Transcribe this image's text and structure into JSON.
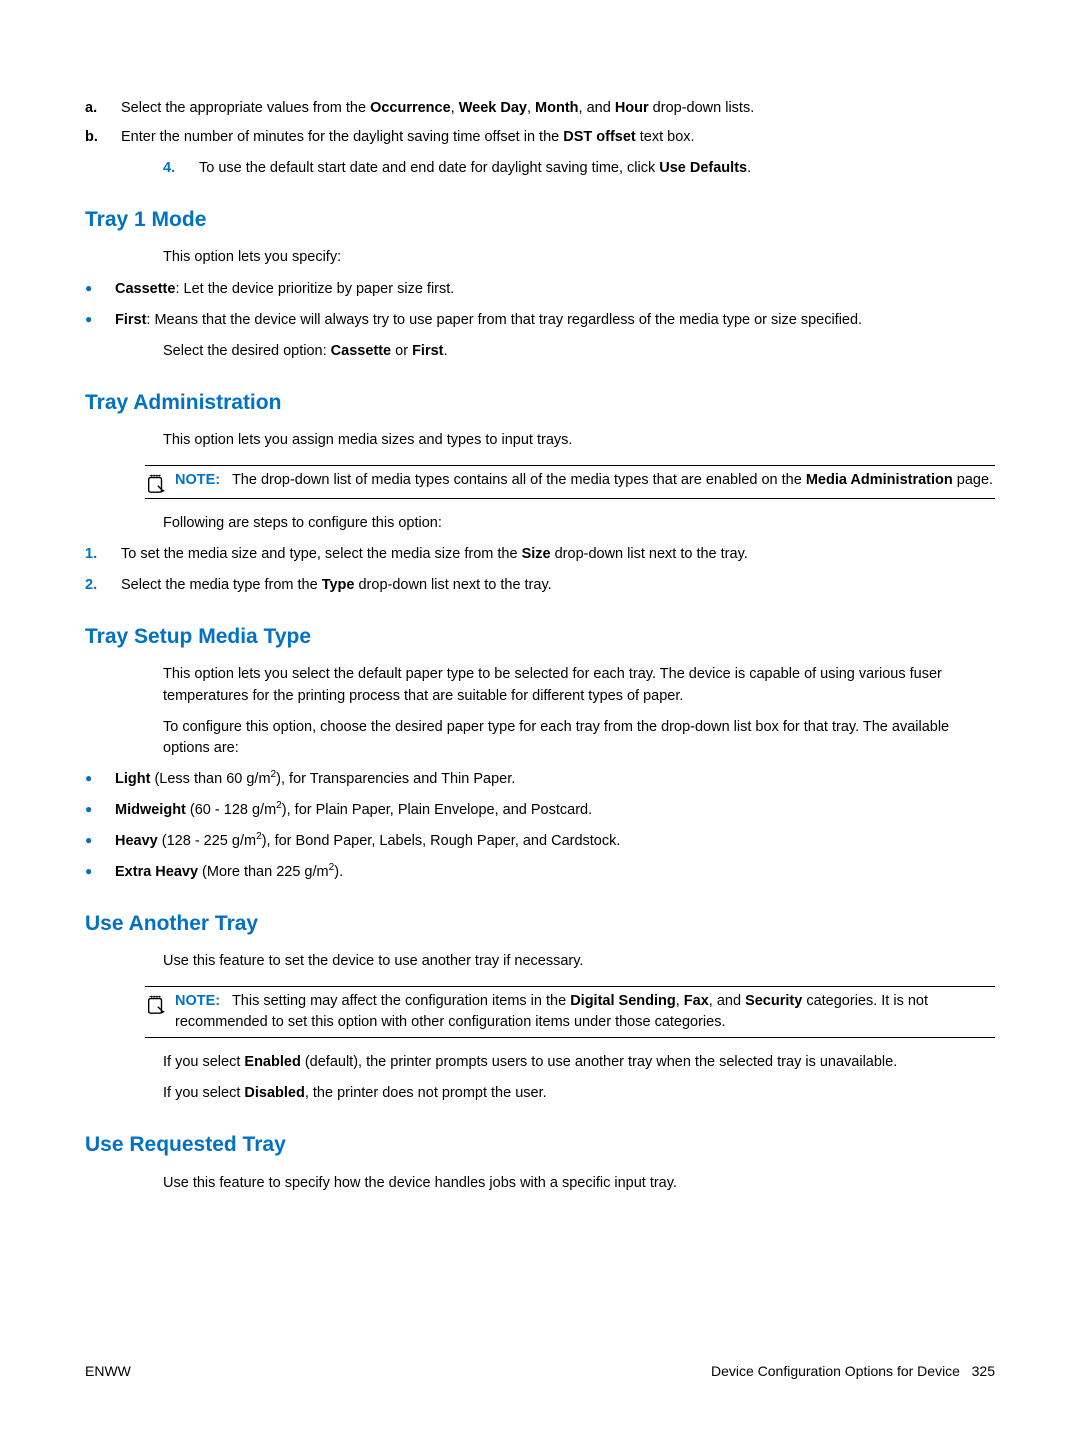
{
  "topList": {
    "a": {
      "marker": "a.",
      "pre": "Select the appropriate values from the ",
      "b1": "Occurrence",
      "sep1": ", ",
      "b2": "Week Day",
      "sep2": ", ",
      "b3": "Month",
      "sep3": ", and ",
      "b4": "Hour",
      "post": " drop-down lists."
    },
    "b": {
      "marker": "b.",
      "pre": "Enter the number of minutes for the daylight saving time offset in the ",
      "b1": "DST offset",
      "post": " text box."
    },
    "step4": {
      "marker": "4.",
      "pre": "To use the default start date and end date for daylight saving time, click ",
      "b1": "Use Defaults",
      "post": "."
    }
  },
  "tray1": {
    "heading": "Tray 1 Mode",
    "intro": "This option lets you specify:",
    "bullets": {
      "cassette": {
        "b": "Cassette",
        "post": ": Let the device prioritize by paper size first."
      },
      "first": {
        "b": "First",
        "post": ": Means that the device will always try to use paper from that tray regardless of the media type or size specified."
      }
    },
    "select": {
      "pre": "Select the desired option: ",
      "b1": "Cassette",
      "mid": " or ",
      "b2": "First",
      "post": "."
    }
  },
  "trayAdmin": {
    "heading": "Tray Administration",
    "intro": "This option lets you assign media sizes and types to input trays.",
    "note": {
      "label": "NOTE:",
      "pre": "The drop-down list of media types contains all of the media types that are enabled on the ",
      "b1": "Media Administration",
      "post": " page."
    },
    "follow": "Following are steps to configure this option:",
    "steps": {
      "s1": {
        "marker": "1.",
        "pre": "To set the media size and type, select the media size from the ",
        "b1": "Size",
        "post": " drop-down list next to the tray."
      },
      "s2": {
        "marker": "2.",
        "pre": "Select the media type from the ",
        "b1": "Type",
        "post": " drop-down list next to the tray."
      }
    }
  },
  "traySetup": {
    "heading": "Tray Setup Media Type",
    "p1": "This option lets you select the default paper type to be selected for each tray. The device is capable of using various fuser temperatures for the printing process that are suitable for different types of paper.",
    "p2": "To configure this option, choose the desired paper type for each tray from the drop-down list box for that tray. The available options are:",
    "bullets": {
      "light": {
        "b": "Light",
        "mid1": " (Less than 60 g/m",
        "sup": "2",
        "mid2": "), for Transparencies and Thin Paper."
      },
      "mid": {
        "b": "Midweight",
        "mid1": " (60 - 128 g/m",
        "sup": "2",
        "mid2": "), for Plain Paper, Plain Envelope, and Postcard."
      },
      "heavy": {
        "b": "Heavy",
        "mid1": " (128 - 225 g/m",
        "sup": "2",
        "mid2": "), for Bond Paper, Labels, Rough Paper, and Cardstock."
      },
      "extra": {
        "b": "Extra Heavy",
        "mid1": " (More than 225 g/m",
        "sup": "2",
        "mid2": ")."
      }
    }
  },
  "useAnother": {
    "heading": "Use Another Tray",
    "intro": "Use this feature to set the device to use another tray if necessary.",
    "note": {
      "label": "NOTE:",
      "pre": "This setting may affect the configuration items in the ",
      "b1": "Digital Sending",
      "sep1": ", ",
      "b2": "Fax",
      "sep2": ", and ",
      "b3": "Security",
      "post": " categories. It is not recommended to set this option with other configuration items under those categories."
    },
    "p1": {
      "pre": "If you select ",
      "b1": "Enabled",
      "post": " (default), the printer prompts users to use another tray when the selected tray is unavailable."
    },
    "p2": {
      "pre": "If you select ",
      "b1": "Disabled",
      "post": ", the printer does not prompt the user."
    }
  },
  "useRequested": {
    "heading": "Use Requested Tray",
    "intro": "Use this feature to specify how the device handles jobs with a specific input tray."
  },
  "footer": {
    "left": "ENWW",
    "rightLabel": "Device Configuration Options for Device",
    "pageNum": "325"
  }
}
